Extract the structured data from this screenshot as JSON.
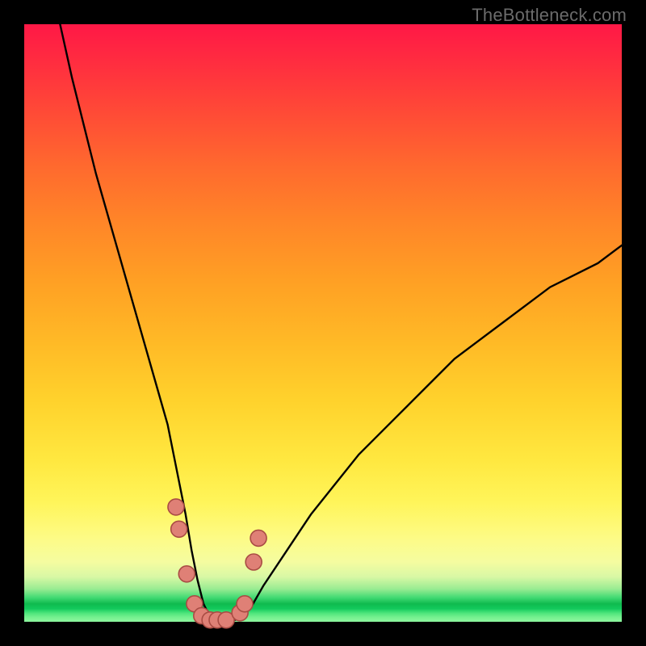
{
  "branding": {
    "text": "TheBottleneck.com"
  },
  "chart_data": {
    "type": "line",
    "title": "",
    "xlabel": "",
    "ylabel": "",
    "xlim": [
      0,
      100
    ],
    "ylim": [
      0,
      100
    ],
    "grid": false,
    "legend": false,
    "series": [
      {
        "name": "bottleneck-curve",
        "x": [
          6,
          8,
          10,
          12,
          14,
          16,
          18,
          20,
          22,
          24,
          25,
          26,
          27,
          28,
          29,
          30,
          31,
          32,
          33,
          34,
          36,
          38,
          40,
          44,
          48,
          52,
          56,
          60,
          64,
          68,
          72,
          76,
          80,
          84,
          88,
          92,
          96,
          100
        ],
        "y": [
          100,
          91,
          83,
          75,
          68,
          61,
          54,
          47,
          40,
          33,
          28,
          23,
          18,
          12,
          7,
          3,
          1,
          0,
          0,
          0,
          0.5,
          2.5,
          6,
          12,
          18,
          23,
          28,
          32,
          36,
          40,
          44,
          47,
          50,
          53,
          56,
          58,
          60,
          63
        ]
      }
    ],
    "markers": {
      "name": "highlight-points",
      "x": [
        25.4,
        25.9,
        27.2,
        28.5,
        29.7,
        31.1,
        32.3,
        33.8,
        36.1,
        36.9,
        38.4,
        39.2
      ],
      "y": [
        19.2,
        15.5,
        8.0,
        3.0,
        1.0,
        0.3,
        0.3,
        0.3,
        1.5,
        3.0,
        10.0,
        14.0
      ],
      "r": 10,
      "fill": "#df8076",
      "stroke": "#a94c44"
    },
    "background_gradient": {
      "top": "#ff1846",
      "mid": "#ffd22c",
      "green_band": "#0fbb4e",
      "bottom": "#8ef69f"
    }
  }
}
